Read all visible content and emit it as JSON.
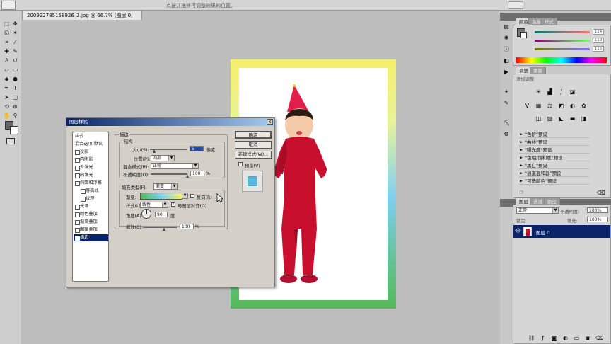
{
  "optionbar": {
    "hint": "点按并拖移可调整效果的位置。"
  },
  "document": {
    "tab_title": "200922785158926_2.jpg @ 66.7% (图层 0, RGB/8#) *"
  },
  "dialog": {
    "title": "图层样式",
    "close": "x",
    "styles_header": "样式",
    "blend_default": "混合选项:默认",
    "styles": [
      {
        "label": "投影",
        "checked": false
      },
      {
        "label": "内阴影",
        "checked": false
      },
      {
        "label": "外发光",
        "checked": false
      },
      {
        "label": "内发光",
        "checked": false
      },
      {
        "label": "斜面和浮雕",
        "checked": false
      },
      {
        "label": "等高线",
        "checked": false
      },
      {
        "label": "纹理",
        "checked": false
      },
      {
        "label": "光泽",
        "checked": false
      },
      {
        "label": "颜色叠加",
        "checked": false
      },
      {
        "label": "渐变叠加",
        "checked": false
      },
      {
        "label": "图案叠加",
        "checked": false
      },
      {
        "label": "描边",
        "checked": true
      }
    ],
    "stroke_header": "描边",
    "structure_header": "结构",
    "size_label": "大小(S):",
    "size_value": "5",
    "size_unit": "像素",
    "position_label": "位置(P):",
    "position_value": "内部",
    "blend_mode_label": "混合模式(B):",
    "blend_mode_value": "正常",
    "opacity_label": "不透明度(O):",
    "opacity_value": "100",
    "opacity_unit": "%",
    "fill_type_label": "填充类型(F):",
    "fill_type_value": "渐变",
    "gradient_label": "渐变:",
    "reverse_label": "反向(R)",
    "style_label": "样式(L):",
    "style_value": "线性",
    "align_label": "与图层对齐(G)",
    "angle_label": "角度(A):",
    "angle_value": "90",
    "angle_unit": "度",
    "scale_label": "缩放(C):",
    "scale_value": "100",
    "scale_unit": "%",
    "ok": "确定",
    "cancel": "取消",
    "new_style": "新建样式(W)...",
    "preview_label": "预览(V)"
  },
  "panels": {
    "color_tabs": [
      "颜色",
      "色板",
      "样式"
    ],
    "color_values": {
      "r": "124",
      "g": "119",
      "b": "115"
    },
    "adjust_tabs": [
      "调整",
      "蒙版"
    ],
    "adjust_title": "添加调整",
    "presets": [
      "\"色阶\"预设",
      "\"曲线\"预设",
      "\"曝光度\"预设",
      "\"色相/饱和度\"预设",
      "\"黑白\"预设",
      "\"通道混和器\"预设",
      "\"可选颜色\"预设"
    ],
    "layer_tabs": [
      "图层",
      "通道",
      "路径"
    ],
    "blend_mode": "正常",
    "opacity_label": "不透明度:",
    "opacity_value": "100%",
    "fill_label": "填充:",
    "fill_value": "100%",
    "lock_label": "锁定:",
    "layer_name": "图层 0"
  },
  "colors": {
    "accent": "#0a246a",
    "frame_top": "#f6ef6a",
    "frame_mid": "#7fd0f0",
    "frame_bottom": "#56b957",
    "girl_red": "#c8102e"
  }
}
